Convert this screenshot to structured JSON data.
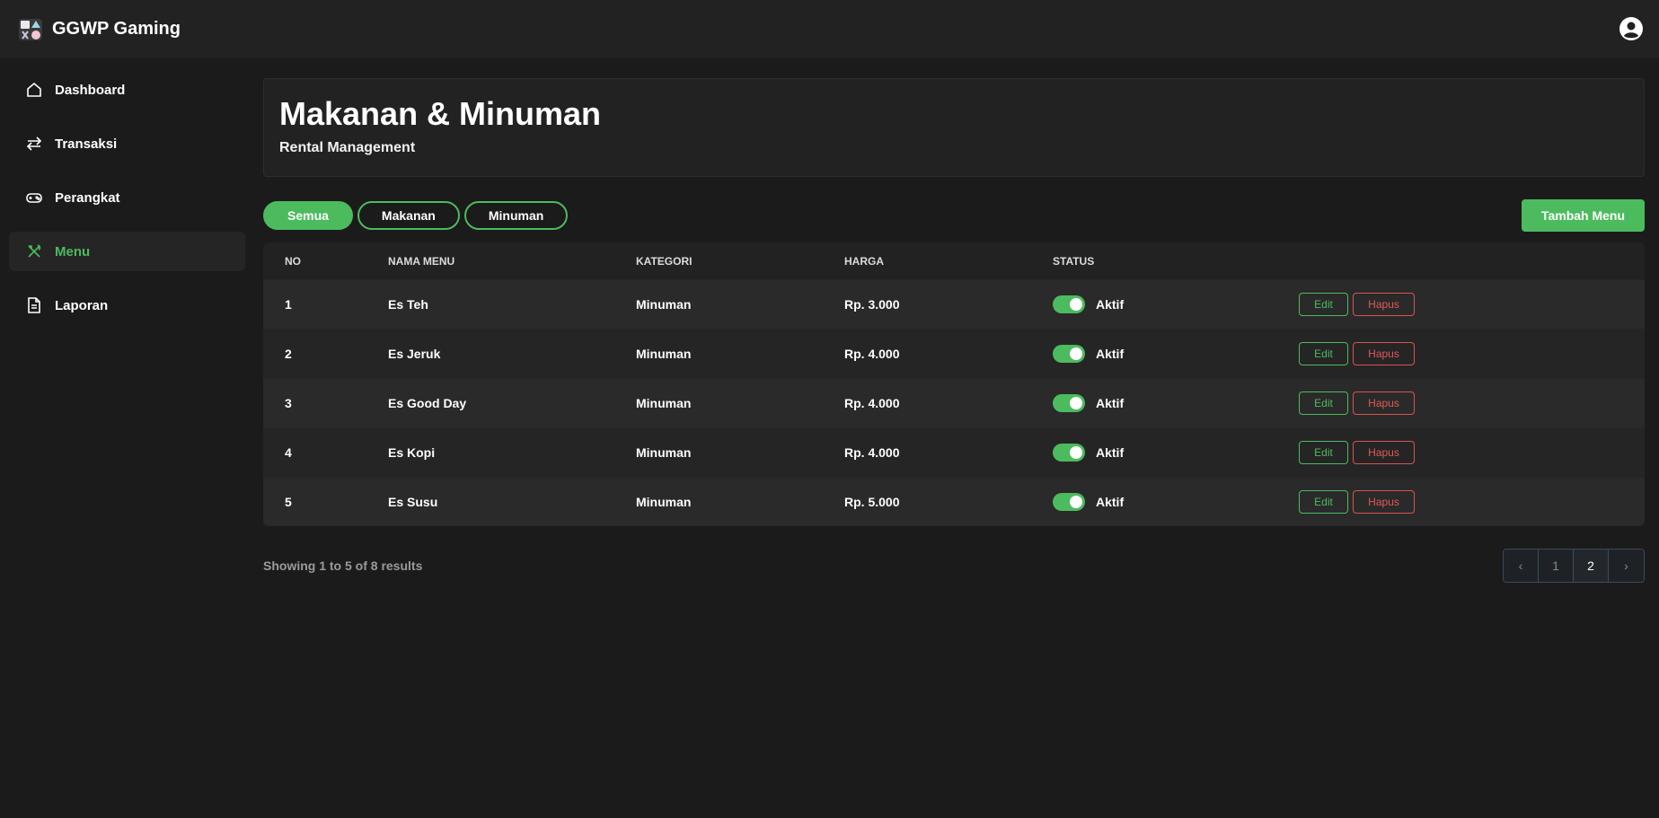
{
  "app": {
    "name": "GGWP Gaming"
  },
  "sidebar": {
    "items": [
      {
        "label": "Dashboard",
        "icon": "home-icon"
      },
      {
        "label": "Transaksi",
        "icon": "transfer-icon"
      },
      {
        "label": "Perangkat",
        "icon": "gamepad-icon"
      },
      {
        "label": "Menu",
        "icon": "utensils-icon",
        "active": true
      },
      {
        "label": "Laporan",
        "icon": "document-icon"
      }
    ]
  },
  "header": {
    "title": "Makanan & Minuman",
    "subtitle": "Rental Management"
  },
  "filters": {
    "all": "Semua",
    "food": "Makanan",
    "drink": "Minuman",
    "active": "Semua"
  },
  "actions": {
    "add_label": "Tambah Menu"
  },
  "table": {
    "headers": {
      "no": "NO",
      "name": "NAMA MENU",
      "category": "KATEGORI",
      "price": "HARGA",
      "status": "STATUS"
    },
    "rows": [
      {
        "no": "1",
        "name": "Es Teh",
        "category": "Minuman",
        "price": "Rp. 3.000",
        "status": "Aktif",
        "edit": "Edit",
        "delete": "Hapus"
      },
      {
        "no": "2",
        "name": "Es Jeruk",
        "category": "Minuman",
        "price": "Rp. 4.000",
        "status": "Aktif",
        "edit": "Edit",
        "delete": "Hapus"
      },
      {
        "no": "3",
        "name": "Es Good Day",
        "category": "Minuman",
        "price": "Rp. 4.000",
        "status": "Aktif",
        "edit": "Edit",
        "delete": "Hapus"
      },
      {
        "no": "4",
        "name": "Es Kopi",
        "category": "Minuman",
        "price": "Rp. 4.000",
        "status": "Aktif",
        "edit": "Edit",
        "delete": "Hapus"
      },
      {
        "no": "5",
        "name": "Es Susu",
        "category": "Minuman",
        "price": "Rp. 5.000",
        "status": "Aktif",
        "edit": "Edit",
        "delete": "Hapus"
      }
    ]
  },
  "pagination": {
    "summary": "Showing 1 to 5 of 8 results",
    "prev": "‹",
    "pages": [
      "1",
      "2"
    ],
    "current": "2",
    "next": "›"
  },
  "colors": {
    "accent": "#4cbb5e",
    "danger": "#e05a55",
    "background": "#1b1b1b",
    "surface": "#222222"
  }
}
